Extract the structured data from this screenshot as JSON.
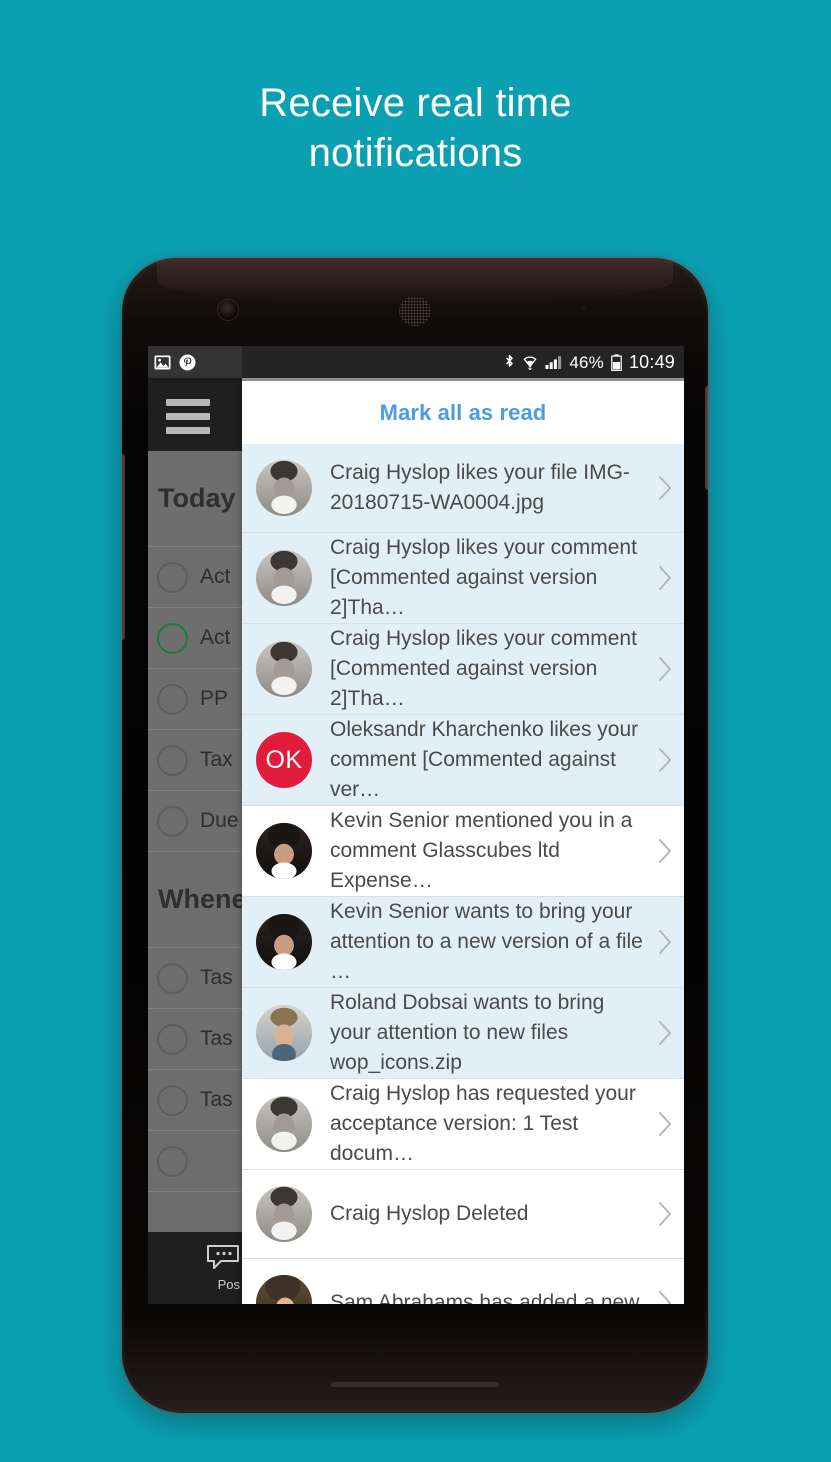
{
  "headline": {
    "line1": "Receive real time",
    "line2": "notifications"
  },
  "theme": {
    "background_teal": "#0b9fb2",
    "accent_blue": "#4a9de4",
    "unread_row": "#e2eff7",
    "read_row": "#ffffff",
    "initials_avatar_red": "#e01b3c"
  },
  "statusbar": {
    "left_icons": [
      "image-icon",
      "pinterest-icon"
    ],
    "right_icons": [
      "bluetooth-icon",
      "wifi-icon",
      "signal-icon",
      "battery-icon"
    ],
    "battery_percent": "46%",
    "clock": "10:49"
  },
  "background_app": {
    "menu_icon": "hamburger-menu-icon",
    "sections": [
      {
        "type": "header",
        "label": "Today"
      },
      {
        "type": "task",
        "label": "Act",
        "state": "incomplete"
      },
      {
        "type": "task",
        "label": "Act",
        "state": "active"
      },
      {
        "type": "task",
        "label": "PP",
        "state": "incomplete"
      },
      {
        "type": "task",
        "label": "Tax",
        "state": "incomplete"
      },
      {
        "type": "task",
        "label": "Due",
        "state": "incomplete"
      },
      {
        "type": "header",
        "label": "Whene"
      },
      {
        "type": "task",
        "label": "Tas",
        "state": "incomplete"
      },
      {
        "type": "task",
        "label": "Tas",
        "state": "incomplete"
      },
      {
        "type": "task",
        "label": "Tas",
        "state": "incomplete"
      }
    ],
    "bottom_bar": {
      "icon": "chat-bubble-icon",
      "label": "Pos"
    }
  },
  "drawer": {
    "mark_all_label": "Mark all as read",
    "notifications": [
      {
        "text": "Craig Hyslop likes your file IMG-20180715-WA0004.jpg",
        "avatar_type": "photo",
        "avatar_style": "ph-a",
        "unread": true,
        "chevron": "chevron-right-icon"
      },
      {
        "text": "Craig Hyslop likes your comment [Commented against version 2]Tha…",
        "avatar_type": "photo",
        "avatar_style": "ph-a",
        "unread": true,
        "chevron": "chevron-right-icon"
      },
      {
        "text": "Craig Hyslop likes your comment [Commented against version 2]Tha…",
        "avatar_type": "photo",
        "avatar_style": "ph-a",
        "unread": true,
        "chevron": "chevron-right-icon"
      },
      {
        "text": "Oleksandr Kharchenko likes your comment [Commented against ver…",
        "avatar_type": "initials",
        "avatar_initials": "OK",
        "unread": true,
        "chevron": "chevron-right-icon"
      },
      {
        "text": "Kevin Senior mentioned you in a comment Glasscubes ltd Expense…",
        "avatar_type": "photo",
        "avatar_style": "ph-b",
        "unread": false,
        "chevron": "chevron-right-icon"
      },
      {
        "text": "Kevin Senior wants to bring your attention to a new version of a file …",
        "avatar_type": "photo",
        "avatar_style": "ph-b",
        "unread": true,
        "chevron": "chevron-right-icon"
      },
      {
        "text": "Roland Dobsai wants to bring your attention to new files wop_icons.zip",
        "avatar_type": "photo",
        "avatar_style": "ph-c",
        "unread": true,
        "chevron": "chevron-right-icon"
      },
      {
        "text": "Craig Hyslop has requested your acceptance version: 1 Test docum…",
        "avatar_type": "photo",
        "avatar_style": "ph-a",
        "unread": false,
        "chevron": "chevron-right-icon"
      },
      {
        "text": "Craig Hyslop Deleted",
        "avatar_type": "photo",
        "avatar_style": "ph-a",
        "unread": false,
        "chevron": "chevron-right-icon"
      },
      {
        "text": "Sam Abrahams has added a new",
        "avatar_type": "photo",
        "avatar_style": "ph-d",
        "unread": false,
        "chevron": "chevron-right-icon"
      }
    ]
  }
}
